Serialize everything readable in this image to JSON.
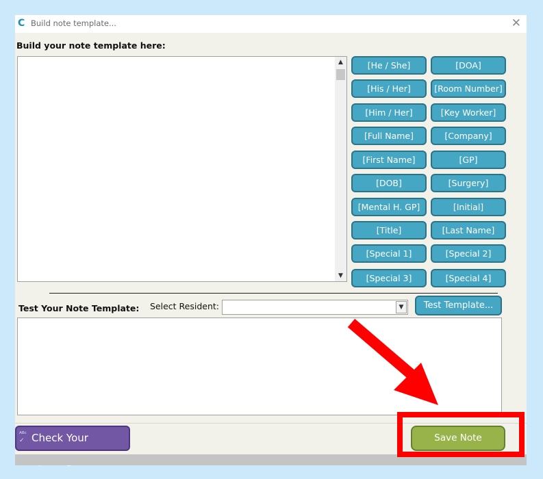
{
  "window": {
    "title": "Build note template..."
  },
  "builder": {
    "heading": "Build your note template here:"
  },
  "tags": [
    "[He / She]",
    "[DOA]",
    "[His / Her]",
    "[Room Number]",
    "[Him / Her]",
    "[Key Worker]",
    "[Full Name]",
    "[Company]",
    "[First Name]",
    "[GP]",
    "[DOB]",
    "[Surgery]",
    "[Mental H. GP]",
    "[Initial]",
    "[Title]",
    "[Last Name]",
    "[Special 1]",
    "[Special 2]",
    "[Special 3]",
    "[Special 4]"
  ],
  "test": {
    "heading": "Test Your Note Template:",
    "select_label": "Select Resident:",
    "select_value": "",
    "button_label": "Test Template..."
  },
  "footer": {
    "spell_label": "Check Your Spelling",
    "save_label": "Save Note Template"
  },
  "icons": {
    "app": "app-c-logo-icon",
    "close": "close-icon",
    "spell": "spellcheck-icon"
  },
  "colors": {
    "tag_button": "#45a7c3",
    "spell_button": "#7157a4",
    "save_button": "#97b34a",
    "highlight": "#ff0000",
    "arrow": "#ff0000"
  }
}
